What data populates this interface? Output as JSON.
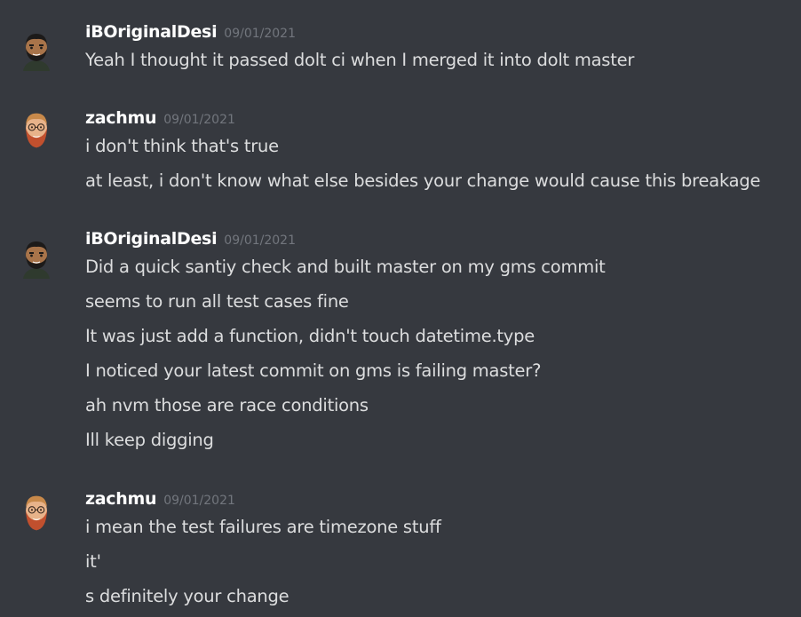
{
  "groups": [
    {
      "author": "iBOriginalDesi",
      "timestamp": "09/01/2021",
      "avatar_icon": "dark-hair-bearded-man-avatar-icon",
      "messages": [
        "Yeah I thought it passed dolt ci when I merged it into dolt master"
      ]
    },
    {
      "author": "zachmu",
      "timestamp": "09/01/2021",
      "avatar_icon": "red-bearded-man-avatar-icon",
      "messages": [
        "i don't think that's true",
        "at least, i don't know what else besides your change would cause this breakage"
      ]
    },
    {
      "author": "iBOriginalDesi",
      "timestamp": "09/01/2021",
      "avatar_icon": "dark-hair-bearded-man-avatar-icon",
      "messages": [
        "Did a quick santiy check and built master on my gms commit",
        "seems to run all test cases fine",
        "It was just add a function, didn't touch datetime.type",
        "I noticed your latest commit on gms is failing master?",
        "ah nvm those are race conditions",
        "Ill keep digging"
      ]
    },
    {
      "author": "zachmu",
      "timestamp": "09/01/2021",
      "avatar_icon": "red-bearded-man-avatar-icon",
      "messages": [
        "i mean the test failures are timezone stuff",
        "it'",
        "s definitely your change"
      ]
    }
  ],
  "colors": {
    "background": "#36393f",
    "author": "#ffffff",
    "timestamp": "#72767d",
    "message": "#dcddde"
  }
}
